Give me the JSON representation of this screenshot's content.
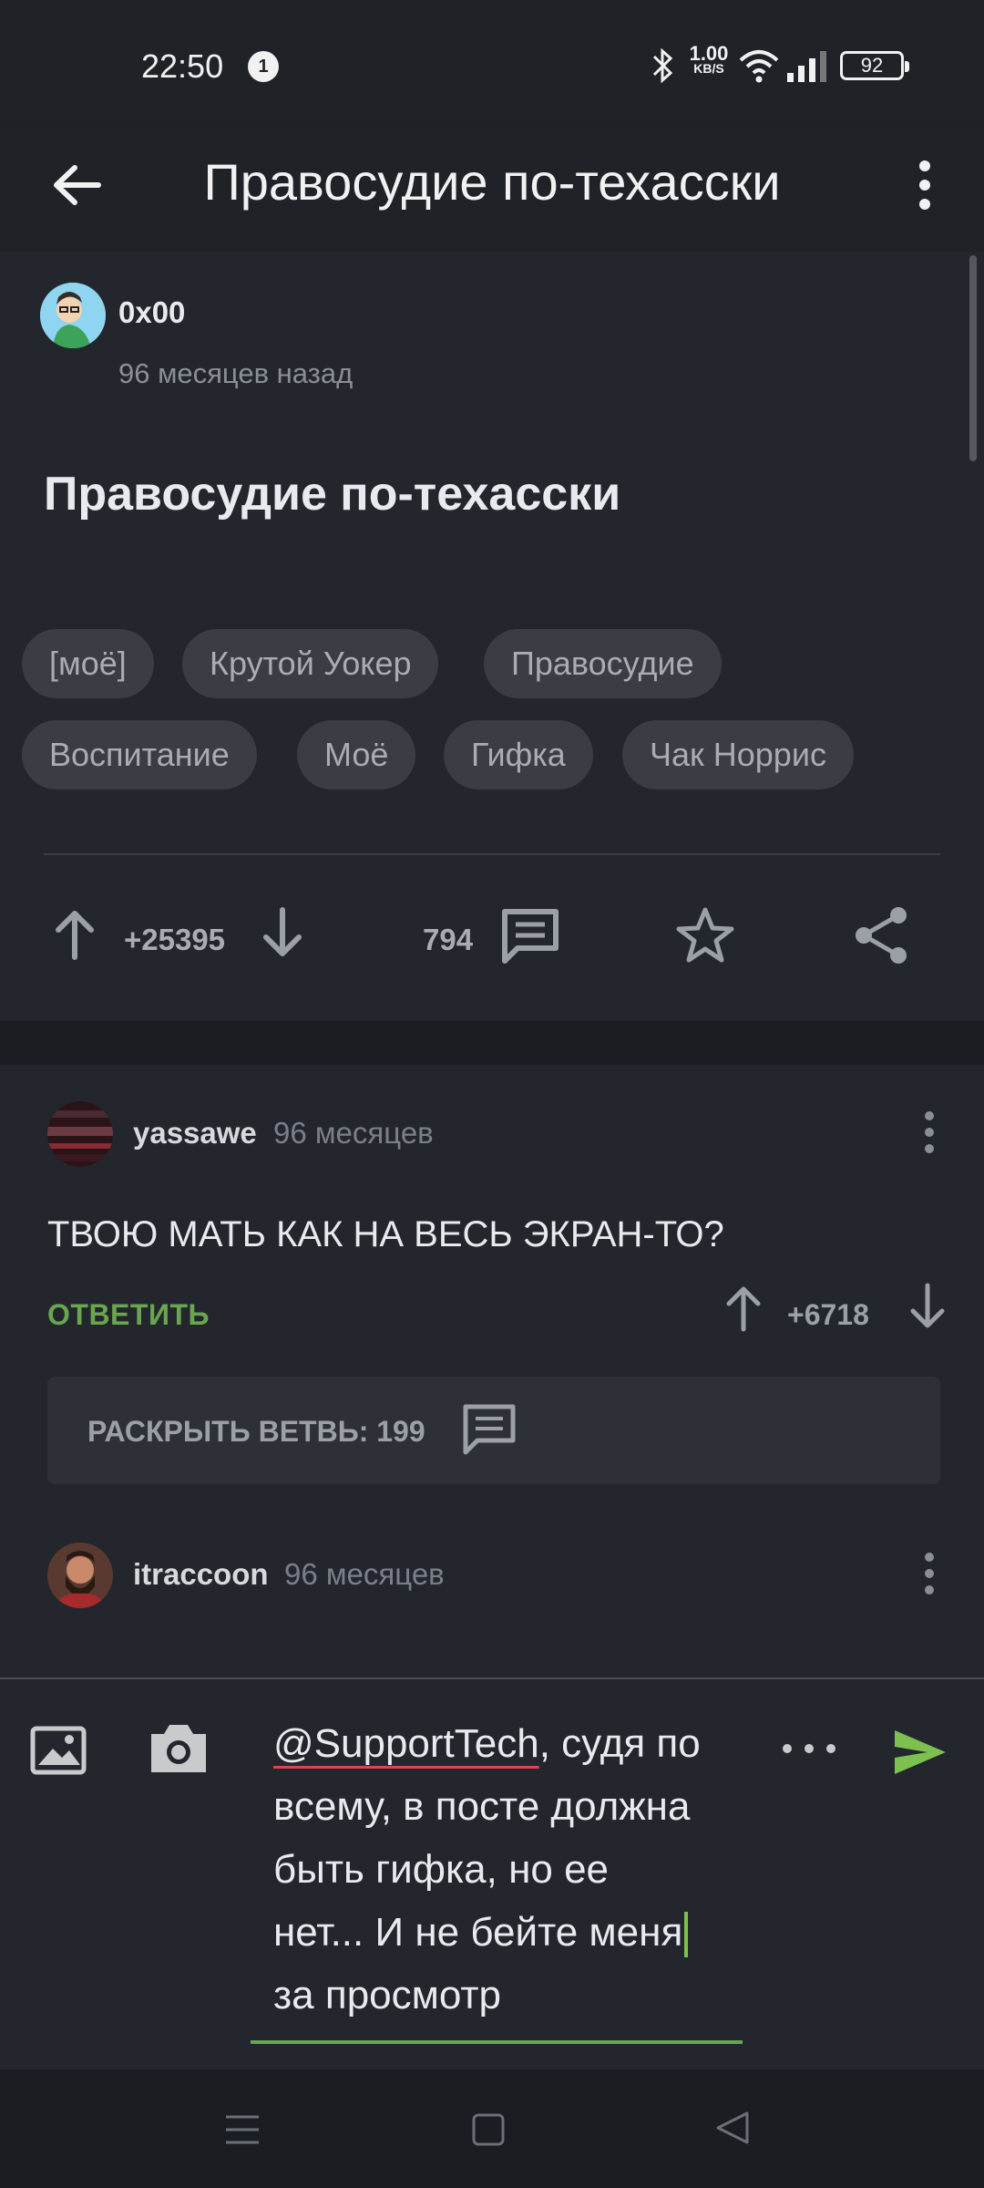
{
  "status_bar": {
    "time": "22:50",
    "notification_count": "1",
    "net_speed_value": "1.00",
    "net_speed_unit": "KB/S",
    "battery": "92"
  },
  "app_bar": {
    "title": "Правосудие по-техасски"
  },
  "post": {
    "author": "0x00",
    "time": "96 месяцев назад",
    "title": "Правосудие по-техасски",
    "tags": [
      "[моё]",
      "Крутой Уокер",
      "Правосудие",
      "Воспитание",
      "Моё",
      "Гифка",
      "Чак Норрис"
    ],
    "rating": "+25395",
    "comments_count": "794"
  },
  "comments": [
    {
      "author": "yassawe",
      "time": "96 месяцев",
      "text": "ТВОЮ МАТЬ КАК НА ВЕСЬ ЭКРАН-ТО?",
      "reply_label": "ОТВЕТИТЬ",
      "rating": "+6718",
      "branch_label": "РАСКРЫТЬ ВЕТВЬ: 199"
    },
    {
      "author": "itraccoon",
      "time": "96 месяцев"
    }
  ],
  "input": {
    "mention": "@SupportTech",
    "text_line1_rest": ", судя по",
    "text_line2": "всему, в посте должна",
    "text_line3": "быть гифка, но ее",
    "text_line4": "нет... И не бейте меня",
    "text_line5": "за просмотр",
    "dots_label": "• • •"
  },
  "colors": {
    "background": "#23272d",
    "bar": "#1f2328",
    "accent_green": "#6aa54f",
    "text": "#e8eaed",
    "muted": "#8a8f96"
  }
}
